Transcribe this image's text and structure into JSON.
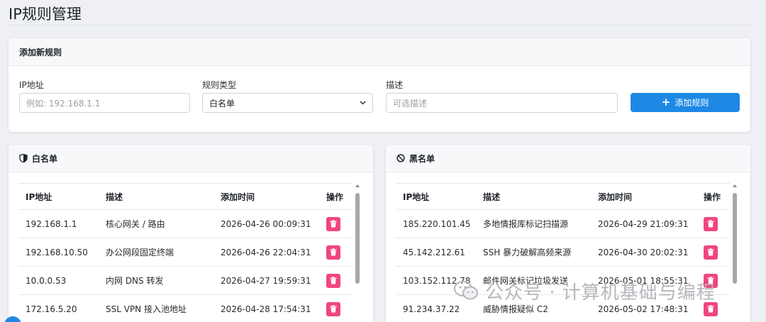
{
  "page": {
    "title": "IP规则管理"
  },
  "add_rule": {
    "header": "添加新规则",
    "ip_label": "IP地址",
    "ip_placeholder": "例如: 192.168.1.1",
    "type_label": "规则类型",
    "type_selected": "白名单",
    "desc_label": "描述",
    "desc_placeholder": "可选描述",
    "button_label": "添加规则"
  },
  "columns": {
    "ip": "IP地址",
    "desc": "描述",
    "time": "添加时间",
    "op": "操作"
  },
  "whitelist": {
    "header": "白名单",
    "rows": [
      {
        "ip": "192.168.1.1",
        "desc": "核心网关 / 路由",
        "time": "2026-04-26 00:09:31"
      },
      {
        "ip": "192.168.10.50",
        "desc": "办公网段固定终端",
        "time": "2026-04-26 22:04:31"
      },
      {
        "ip": "10.0.0.53",
        "desc": "内网 DNS 转发",
        "time": "2026-04-27 19:59:31"
      },
      {
        "ip": "172.16.5.20",
        "desc": "SSL VPN 接入池地址",
        "time": "2026-04-28 17:54:31"
      }
    ]
  },
  "blacklist": {
    "header": "黑名单",
    "rows": [
      {
        "ip": "185.220.101.45",
        "desc": "多地情报库标记扫描源",
        "time": "2026-04-29 21:09:31"
      },
      {
        "ip": "45.142.212.61",
        "desc": "SSH 暴力破解高频来源",
        "time": "2026-04-30 20:02:31"
      },
      {
        "ip": "103.152.112.78",
        "desc": "邮件网关标记垃圾发送",
        "time": "2026-05-01 18:55:31"
      },
      {
        "ip": "91.234.37.22",
        "desc": "威胁情报疑似 C2",
        "time": "2026-05-02 17:48:31"
      }
    ]
  },
  "watermark": {
    "text": "公众号 · 计算机基础与编程"
  },
  "colors": {
    "primary": "#1e88e5",
    "delete": "#f0467e"
  }
}
